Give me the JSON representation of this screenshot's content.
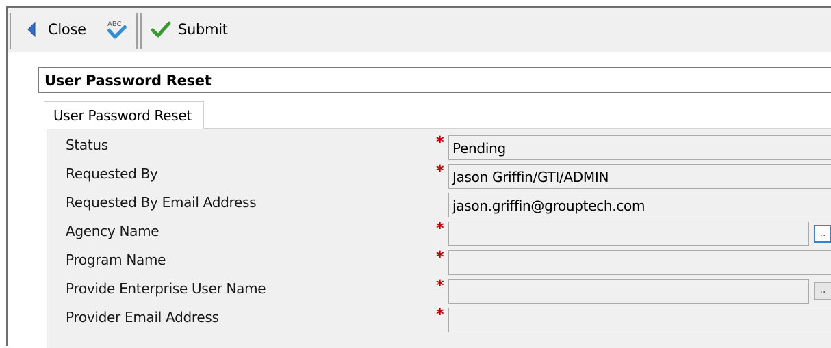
{
  "toolbar": {
    "close_label": "Close",
    "spellcheck_text": "ABC",
    "submit_label": "Submit"
  },
  "form": {
    "title": "User Password Reset",
    "tab_label": "User Password Reset",
    "lookup_glyph": "..",
    "required_marker": "*",
    "fields": [
      {
        "label": "Status",
        "value": "Pending",
        "required": true
      },
      {
        "label": "Requested By",
        "value": "Jason Griffin/GTI/ADMIN",
        "required": true
      },
      {
        "label": "Requested By Email Address",
        "value": "jason.griffin@grouptech.com",
        "required": false
      },
      {
        "label": "Agency Name",
        "value": "",
        "required": true
      },
      {
        "label": "Program Name",
        "value": "",
        "required": true
      },
      {
        "label": "Provide Enterprise User Name",
        "value": "",
        "required": true
      },
      {
        "label": "Provider Email Address",
        "value": "",
        "required": true
      }
    ]
  },
  "colors": {
    "required": "#c00000",
    "lookup_focus": "#2e86d6",
    "close_arrow": "#2f6fc8",
    "check": "#3a9a30"
  },
  "icons": [
    "back-arrow-icon",
    "spellcheck-icon",
    "checkmark-icon",
    "ellipsis-icon"
  ]
}
